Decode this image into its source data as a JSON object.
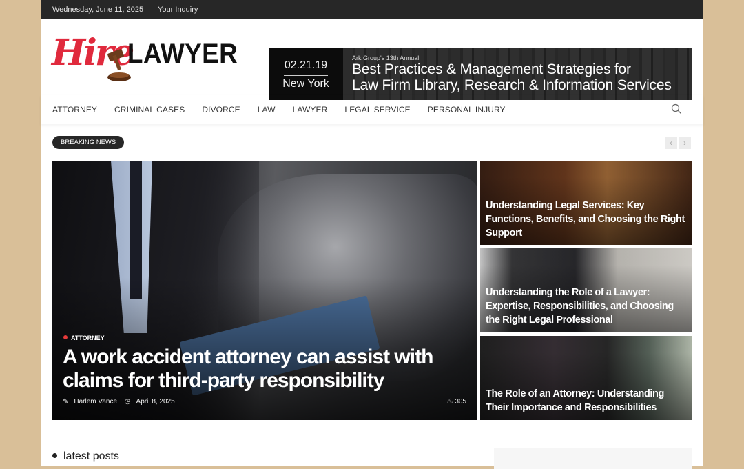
{
  "topbar": {
    "date": "Wednesday, June 11, 2025",
    "inquiry": "Your Inquiry"
  },
  "logo": {
    "script": "Hire",
    "word": "LAWYER",
    "accent": "#e02a3d"
  },
  "banner": {
    "date": "02.21.19",
    "city": "New York",
    "kicker": "Ark Group's 13th Annual:",
    "line1": "Best Practices & Management Strategies for",
    "line2": "Law Firm Library, Research & Information Services"
  },
  "nav": {
    "items": [
      "ATTORNEY",
      "CRIMINAL CASES",
      "DIVORCE",
      "LAW",
      "LAWYER",
      "LEGAL SERVICE",
      "PERSONAL INJURY"
    ],
    "search_icon": "search-icon"
  },
  "breaking": {
    "label": "BREAKING NEWS",
    "prev": "‹",
    "next": "›"
  },
  "hero": {
    "category": "ATTORNEY",
    "title": "A work accident attorney can assist with claims for third-party responsibility",
    "author": "Harlem Vance",
    "date": "April 8, 2025",
    "views": "305"
  },
  "side_posts": [
    {
      "title": "Understanding Legal Services: Key Functions, Benefits, and Choosing the Right Support"
    },
    {
      "title": "Understanding the Role of a Lawyer: Expertise, Responsibilities, and Choosing the Right Legal Professional"
    },
    {
      "title": "The Role of an Attorney: Understanding Their Importance and Responsibilities"
    }
  ],
  "latest": {
    "heading": "latest posts"
  }
}
